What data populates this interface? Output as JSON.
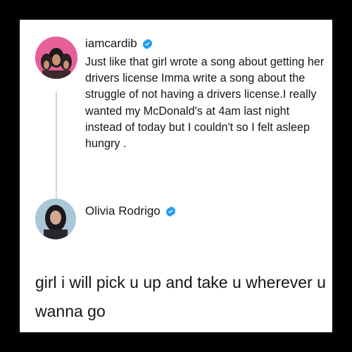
{
  "tweet": {
    "username": "iamcardib",
    "verified_icon": "verified-badge-icon",
    "verified_color": "#1d9bf0",
    "avatar_bg": "#e8609a",
    "text": "Just like that girl wrote a song about getting her drivers license Imma write a song about the struggle of not having a drivers license.I really wanted my McDonald's at 4am last night instead of today but I couldn't so I felt asleep hungry ."
  },
  "reply": {
    "username": "Olivia Rodrigo",
    "verified_icon": "verified-badge-icon",
    "verified_color": "#1d9bf0",
    "avatar_bg": "#a9c7d6",
    "text": "girl i will pick u up and take u wherever u wanna go"
  }
}
